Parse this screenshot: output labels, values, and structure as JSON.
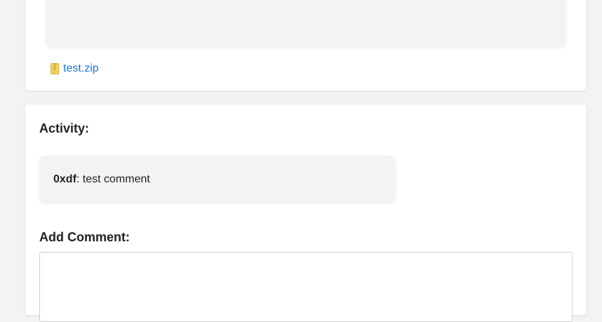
{
  "attachment": {
    "icon": "zip-file-icon",
    "filename": "test.zip",
    "link_color": "#1a73d9"
  },
  "activity": {
    "heading": "Activity:",
    "comments": [
      {
        "author": "0xdf",
        "separator": ": ",
        "text": "test comment"
      }
    ]
  },
  "add_comment": {
    "heading": "Add Comment:",
    "value": "",
    "placeholder": ""
  }
}
